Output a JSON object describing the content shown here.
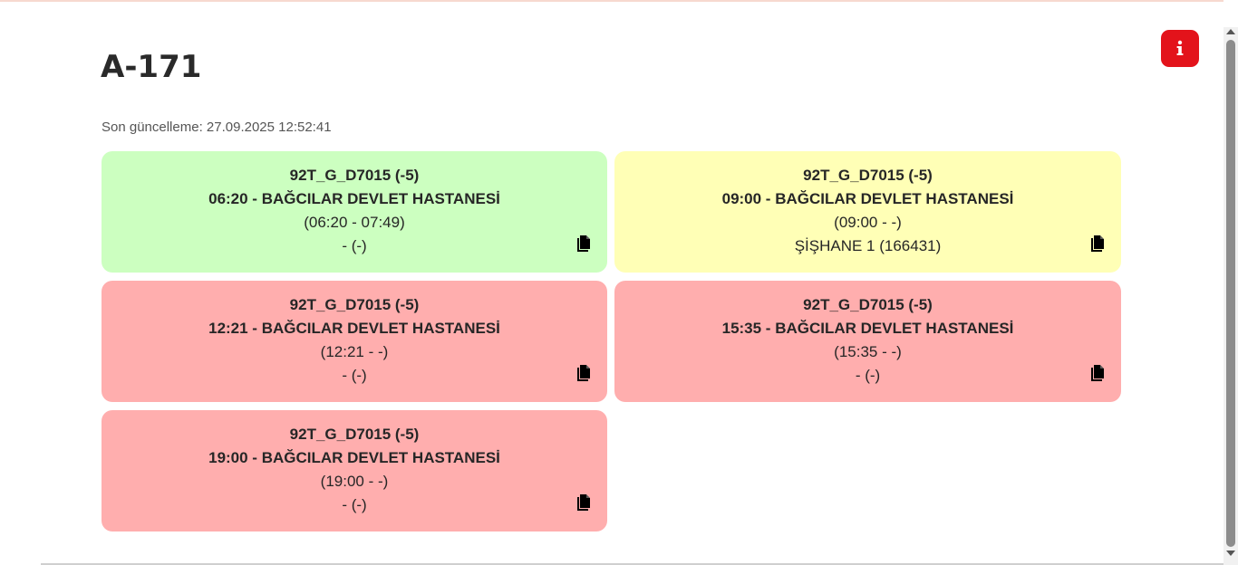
{
  "header": {
    "title": "A-171",
    "last_updated": "Son güncelleme: 27.09.2025 12:52:41"
  },
  "info_button": {
    "icon": "info-icon",
    "color": "#e3131b"
  },
  "colors": {
    "green": "#ccffc0",
    "yellow": "#ffffb6",
    "red": "#ffaeae"
  },
  "cards": [
    {
      "status": "green",
      "code": "92T_G_D7015 (-5)",
      "route": "06:20 - BAĞCILAR DEVLET HASTANESİ",
      "times": "(06:20 - 07:49)",
      "extra": "- (-)"
    },
    {
      "status": "yellow",
      "code": "92T_G_D7015 (-5)",
      "route": "09:00 - BAĞCILAR DEVLET HASTANESİ",
      "times": "(09:00 - -)",
      "extra": "ŞİŞHANE 1 (166431)"
    },
    {
      "status": "red",
      "code": "92T_G_D7015 (-5)",
      "route": "12:21 - BAĞCILAR DEVLET HASTANESİ",
      "times": "(12:21 - -)",
      "extra": "- (-)"
    },
    {
      "status": "red",
      "code": "92T_G_D7015 (-5)",
      "route": "15:35 - BAĞCILAR DEVLET HASTANESİ",
      "times": "(15:35 - -)",
      "extra": "- (-)"
    },
    {
      "status": "red",
      "code": "92T_G_D7015 (-5)",
      "route": "19:00 - BAĞCILAR DEVLET HASTANESİ",
      "times": "(19:00 - -)",
      "extra": "- (-)"
    }
  ]
}
